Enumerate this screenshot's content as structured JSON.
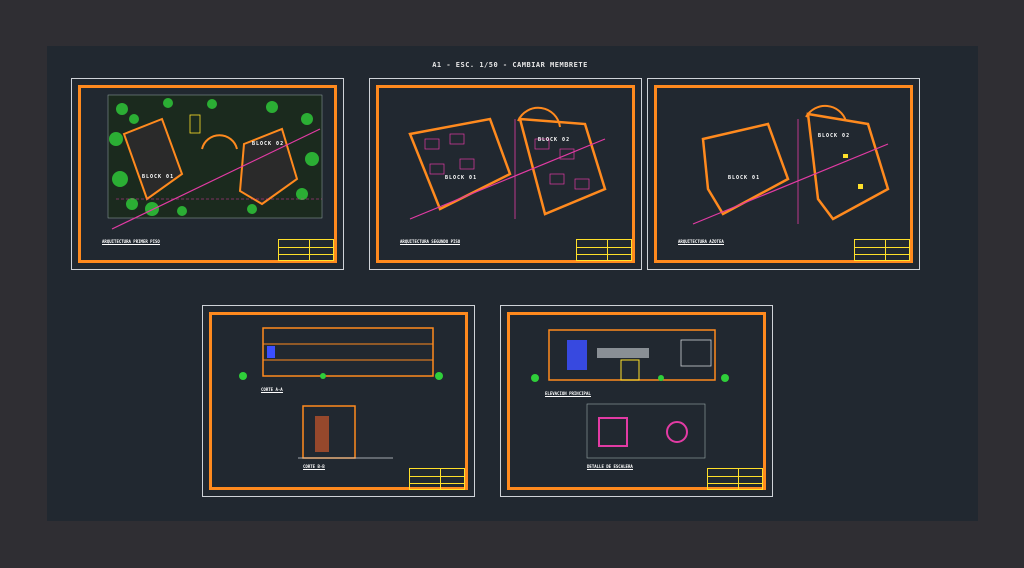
{
  "app": {
    "title": "A1 - ESC. 1/50 - CAMBIAR MEMBRETE"
  },
  "colors": {
    "background": "#2f2e33",
    "canvas": "#212830",
    "frame": "#ff8a1e",
    "title_block": "#ffe02a",
    "axis_line": "#e23ba4",
    "vegetation": "#2fcf3a"
  },
  "sheets": [
    {
      "id": "sheet-1",
      "caption": "ARQUITECTURA PRIMER PISO",
      "labels": [
        "BLOCK 01",
        "BLOCK 02"
      ]
    },
    {
      "id": "sheet-2",
      "caption": "ARQUITECTURA SEGUNDO PISO",
      "labels": [
        "BLOCK 01",
        "BLOCK 02"
      ]
    },
    {
      "id": "sheet-3",
      "caption": "ARQUITECTURA AZOTEA",
      "labels": [
        "BLOCK 01",
        "BLOCK 02"
      ]
    },
    {
      "id": "sheet-4",
      "captions": [
        "CORTE A-A",
        "CORTE B-B"
      ]
    },
    {
      "id": "sheet-5",
      "captions": [
        "ELEVACION PRINCIPAL",
        "DETALLE DE ESCALERA"
      ]
    }
  ]
}
